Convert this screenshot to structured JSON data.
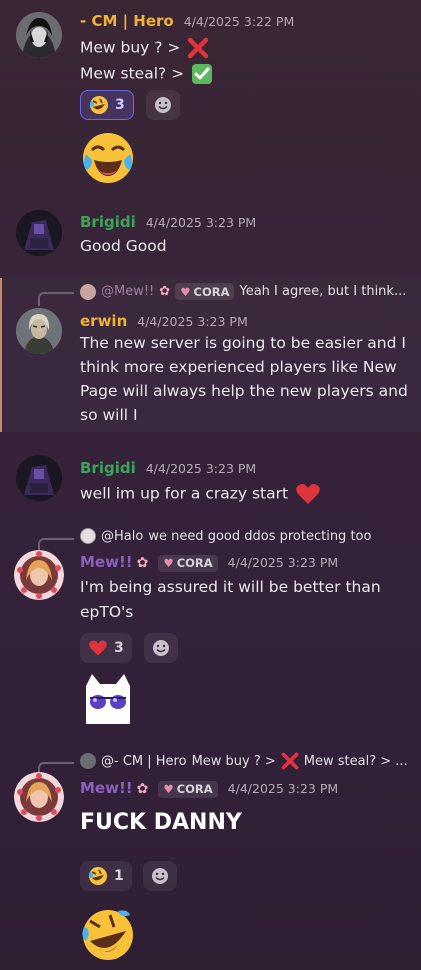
{
  "messages": [
    {
      "username": "- CM | Hero",
      "timestamp": "4/4/2025 3:22 PM",
      "lines": [
        "Mew buy ? >",
        "Mew steal? >"
      ],
      "reactions": [
        {
          "emoji": "rolling-on-floor-laughing",
          "count": "3"
        }
      ]
    },
    {
      "username": "Brigidi",
      "timestamp": "4/4/2025 3:23 PM",
      "lines": [
        "Good Good"
      ]
    },
    {
      "reply": {
        "author": "@Mew!!",
        "tag": "CORA",
        "text": "Yeah I agree, but I think..."
      },
      "username": "erwin",
      "timestamp": "4/4/2025 3:23 PM",
      "lines": [
        "The new server is going to be easier and I",
        "think more experienced players like New",
        "Page will always help the new players and",
        "so will I"
      ]
    },
    {
      "username": "Brigidi",
      "timestamp": "4/4/2025 3:23 PM",
      "lines": [
        "well im up for a crazy start"
      ]
    },
    {
      "reply": {
        "author": "@Halo",
        "text": "we need good ddos protecting too"
      },
      "username": "Mew!!",
      "tag": "CORA",
      "timestamp": "4/4/2025 3:23 PM",
      "lines": [
        "I'm being assured it will be better than",
        "epTO's"
      ],
      "reactions": [
        {
          "emoji": "red-heart",
          "count": "3"
        }
      ]
    },
    {
      "reply": {
        "author": "@- CM | Hero",
        "text1": "Mew buy ? >",
        "text2": "Mew steal? > ..."
      },
      "username": "Mew!!",
      "tag": "CORA",
      "timestamp": "4/4/2025 3:23 PM",
      "lines": [
        "FUCK DANNY"
      ],
      "reactions": [
        {
          "emoji": "rolling-on-floor-laughing",
          "count": "1"
        }
      ]
    }
  ],
  "colors": {
    "hero": "#f0b232",
    "brigidi": "#3ba55c",
    "erwin": "#f0b232",
    "mew": "#8c5fbf",
    "mew_reply": "#a27fa0"
  }
}
